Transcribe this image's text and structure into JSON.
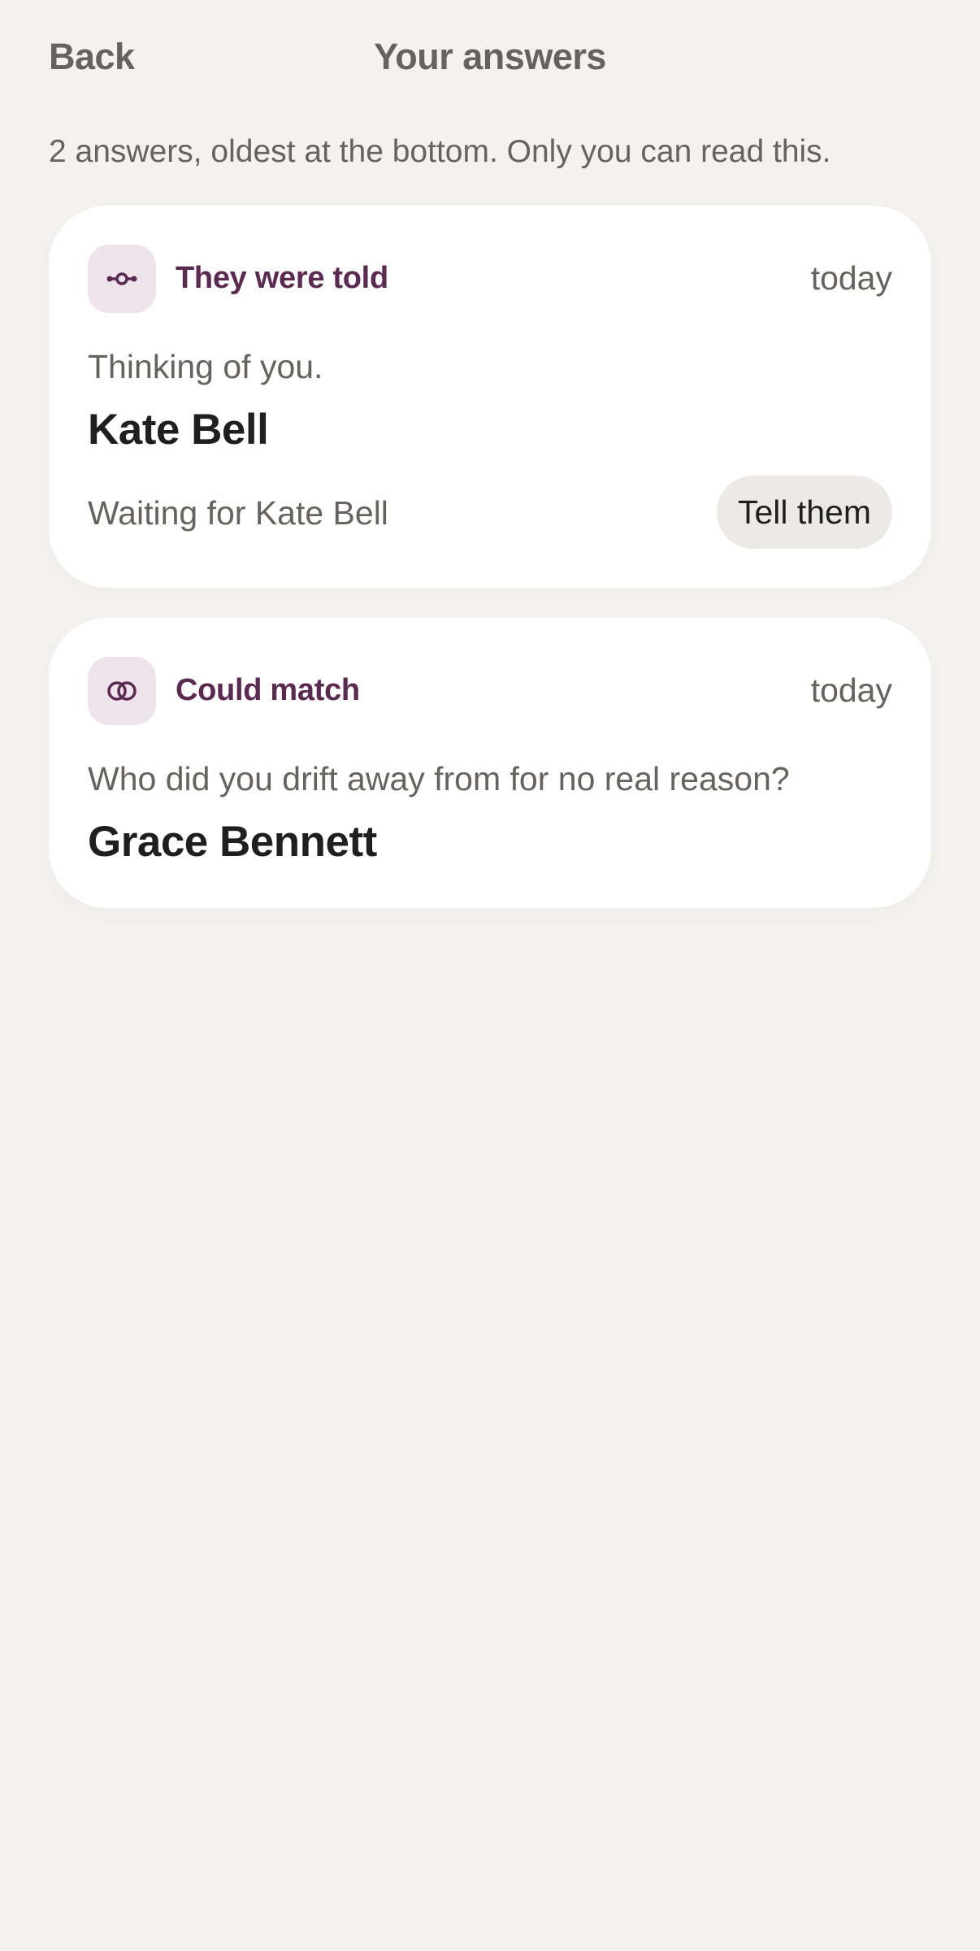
{
  "header": {
    "back_label": "Back",
    "title": "Your answers"
  },
  "subtitle": "2 answers, oldest at the bottom. Only you can read this.",
  "answers": [
    {
      "icon": "told-icon",
      "label": "They were told",
      "time": "today",
      "prompt": "Thinking of you.",
      "name": "Kate Bell",
      "status": "Waiting for Kate Bell",
      "action_label": "Tell them"
    },
    {
      "icon": "match-icon",
      "label": "Could match",
      "time": "today",
      "prompt": "Who did you drift away from for no real reason?",
      "name": "Grace Bennett"
    }
  ],
  "colors": {
    "background": "#f4f2ee",
    "card": "#ffffff",
    "accent": "#5b2a51",
    "icon_tile": "#efe3ec",
    "muted_text": "#66635e",
    "strong_text": "#1f1f1f",
    "button_bg": "#edeae5"
  }
}
